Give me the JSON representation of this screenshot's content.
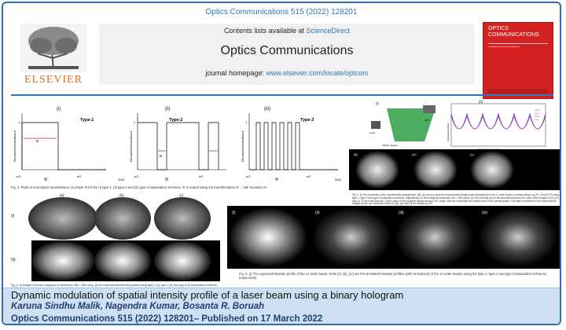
{
  "header": {
    "citation": "Optics Communications 515 (2022) 128201",
    "contents_prefix": "Contents lists available at",
    "contents_link": "ScienceDirect",
    "journal_name": "Optics Communications",
    "homepage_prefix": "journal homepage:",
    "homepage_url": "www.elsevier.com/locate/optcom",
    "publisher": "ELSEVIER",
    "cover_title": "OPTICS COMMUNICATIONS"
  },
  "figure1": {
    "panels": [
      "(i)",
      "(ii)",
      "(iii)"
    ],
    "types": [
      "Type-1",
      "Type-2",
      "Type-3"
    ],
    "ylabel": "Normalized transmittance",
    "ytick": "1",
    "alpha": "α",
    "phi": "Φ",
    "xticks": [
      "-π/2",
      "π/2",
      "3π/2"
    ],
    "caption": "Fig. 1. Plots of normalized transmittance vs phase Φ for the (i) type-1, (ii) type-2 and (iii) type-3 binarization schemes. Φ is scaled using the transformation Φ → ΩΦ modulus 2π"
  },
  "figure2": {
    "cols": [
      "(a)",
      "(b)",
      "(c)"
    ],
    "rows": [
      "(i)",
      "(ii)"
    ],
    "caption": "Fig. 2. (i) Images of binary holograms of dimension 256 × 256 using, (ii) the experimental intensity profiles using type-1 (a), type-2 (b) and type-3 (c) binarization schemes. (iii) The experimental images and simulations of the ±1 order beam in the camera plane corresponding to (a), (b), (c) type-1, type-2 and type-3 binary holograms."
  },
  "figure3": {
    "panels": [
      "(i)",
      "(ii)",
      "(iii)",
      "(iv)",
      "(v)"
    ],
    "setup_labels": [
      "SLM",
      "CMOS camera",
      "Laser"
    ],
    "chart_data": {
      "type": "line",
      "xlabel": "Normalized angle (in deg)",
      "ylabel": "Normalized intensity",
      "legend": [
        "type-1",
        "type-2",
        "type-3",
        "ideal"
      ],
      "series_colors": [
        "#2d6fd1",
        "#d12d6f",
        "#8a2dd1",
        "#aaaaaa"
      ]
    },
    "caption": "Fig. 3. (i) The schematic of the experimental arrangement. (iii), (iv) and (v) show the experimental images (self-normalized) of the ±1 order beams corresponding to φ_R = 2π/(3C70) using type-1, type-2 and type-3 binarization schemes, respectively, for the hologram dimension 180 × 180 pixels. (ii) The intensity plot in the azimuthal direction for each of the images in (iii), (iv) and (v). To be noted that the 1 and x axes of the hologram phase across a 90° angle, with the horizontal and vertical axes of the camera plane. The latter is reflected in the experimental images as the one-dimension beam in (iii), (iv) and (v) are rotated by 45°."
  },
  "figure5": {
    "panels": [
      "(i)",
      "(ii)",
      "(iii)",
      "(iv)"
    ],
    "caption": "Fig. 5. (i) The expected intensity profile of the ±1 order beam, while (ii), (iii), (iv) are the simulated intensity profiles (self normalized) of the ±1 order beams using the type-1, type-2 and type-3 binarization schemes, respectively."
  },
  "banner": {
    "title": "Dynamic modulation of spatial intensity profile of a laser beam using a binary hologram",
    "authors": "Karuna Sindhu Malik, Nagendra Kumar, Bosanta R. Boruah",
    "publication": "Optics Communications 515 (2022) 128201– Published on 17 March 2022"
  },
  "colors": {
    "accent": "#2a7ab8",
    "banner_bg": "#cde0f4",
    "elsevier_orange": "#e06d1b",
    "cover_red": "#d32121"
  }
}
